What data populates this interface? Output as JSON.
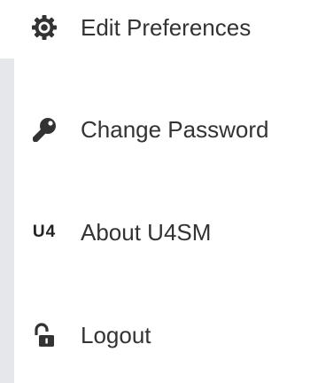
{
  "menu": {
    "items": [
      {
        "label": "Edit Preferences",
        "icon": "gear-icon"
      },
      {
        "label": "Change Password",
        "icon": "key-icon"
      },
      {
        "label": "About U4SM",
        "icon": "u4-logo-icon",
        "icon_text": "U4"
      },
      {
        "label": "Logout",
        "icon": "unlocked-padlock-icon"
      }
    ]
  },
  "colors": {
    "text": "#333333",
    "panel_background": "#ffffff",
    "page_background": "#e6e7ea"
  }
}
